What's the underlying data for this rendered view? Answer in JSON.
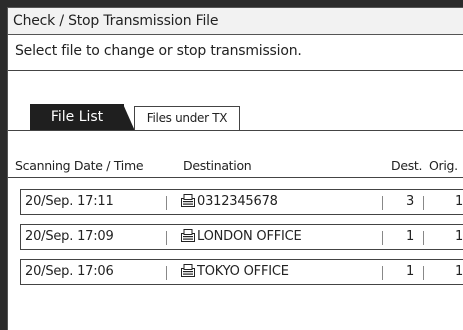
{
  "window": {
    "title": "Check / Stop Transmission File"
  },
  "instruction": "Select file to change or stop transmission.",
  "tabs": [
    {
      "label": "File List",
      "active": true
    },
    {
      "label": "Files under TX",
      "active": false
    }
  ],
  "columns": {
    "date_time": "Scanning Date / Time",
    "destination": "Destination",
    "dest": "Dest.",
    "orig": "Orig."
  },
  "rows": [
    {
      "date_time": "20/Sep. 17:11",
      "destination": "0312345678",
      "dest": "3",
      "orig": "1",
      "icon": "fax-icon"
    },
    {
      "date_time": "20/Sep. 17:09",
      "destination": "LONDON OFFICE",
      "dest": "1",
      "orig": "1",
      "icon": "fax-icon"
    },
    {
      "date_time": "20/Sep. 17:06",
      "destination": "TOKYO OFFICE",
      "dest": "1",
      "orig": "1",
      "icon": "fax-icon"
    }
  ],
  "colors": {
    "frame": "#2b2b2b",
    "active_tab": "#1f1f1f",
    "titlebar": "#f2f2f2"
  }
}
